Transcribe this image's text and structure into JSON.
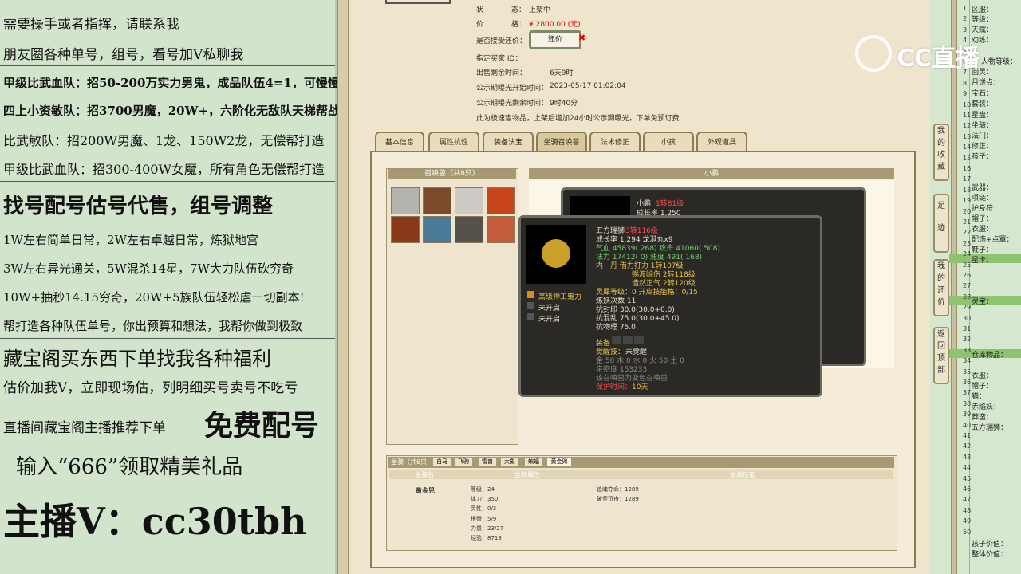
{
  "left_panel": {
    "lines": [
      "需要操手或者指挥，请联系我",
      "朋友圈各种单号，组号，看号加V私聊我",
      "甲级比武血队：招50-200万实力男鬼，成品队伍4=1，可慢慢投资",
      "四上小资敏队：招3700男魔，20W+，六阶化无敌队天梯帮战水陆4等1",
      "比武敏队：招200W男魔、1龙、150W2龙，无偿帮打造",
      "甲级比武血队：招300-400W女魔，所有角色无偿帮打造",
      "找号配号估号代售，组号调整",
      "1W左右简单日常，2W左右卓越日常，炼狱地宫",
      "3W左右异光通关，5W混杀14星，7W大力队伍砍穷奇",
      "10W+抽秒14.15穷奇，20W+5族队伍轻松虐一切副本!",
      "帮打造各种队伍单号，你出预算和想法，我帮你做到极致",
      "藏宝阁买东西下单找我各种福利",
      "估价加我V，立即现场估，列明细买号卖号不吃亏",
      "直播间藏宝阁主播推荐下单",
      "免费配号",
      "输入“666”领取精美礼品",
      "主播V：cc30tbh"
    ]
  },
  "listing": {
    "status_label": "状",
    "status_label2": "态：",
    "status_value": "上架中",
    "price_label": "价",
    "price_label2": "格：",
    "price_value": "¥ 2800.00 (元)",
    "bargain_label": "是否接受还价：",
    "bargain_button": "还价",
    "buyer_id_label": "指定买家 ID：",
    "remaining_label": "出售剩余时间：",
    "remaining_value": "6天9时",
    "public_start_label": "公示期曝光开始时间：",
    "public_start_value": "2023-05-17 01:02:04",
    "public_remaining_label": "公示期曝光剩余时间：",
    "public_remaining_value": "9时40分",
    "notice": "此为极速售物品，上架后增加24小时公示期曝光，下单免预订费"
  },
  "tabs": [
    "基本信息",
    "属性抗性",
    "装备法宝",
    "坐骑召唤兽",
    "法术修正",
    "小孩",
    "外观道具"
  ],
  "summon_panel": {
    "title": "召唤兽（共8只）",
    "child_title": "小鹏"
  },
  "tooltip_back": {
    "name": "小鹏",
    "level": "1转81级",
    "growth": "成长率 1.250"
  },
  "tooltip": {
    "name": "五方瑞狮",
    "level": "3转116级",
    "growth": "成长率 1.294 龙涎丸x9",
    "hp": "气血 45839( 268) 攻击 41060( 508)",
    "mp": "法力 17412( 0) 速度 491( 168)",
    "dan1": "内　丹 借力打力 1转107级",
    "dan2": "赐渡除伤 2转118级",
    "dan3": "造然正气 2转120级",
    "spirit": "灵犀等级：0 开启技能格：0/15",
    "refine": "炼妖次数 11",
    "resist1": "抗封印 30.0(30.0+0.0)",
    "resist2": "抗混乱 75.0(30.0+45.0)",
    "resist3": "抗物理 75.0",
    "equip_label": "装备",
    "awaken": "觉醒技：",
    "awaken_value": "未觉醒",
    "elements": "金 50 木 0 水 0 火 50 土 0",
    "affection": "亲密度 153233",
    "summon_note": "该召唤兽为变色召唤兽",
    "protect": "保护时间：",
    "protect_value": "10天",
    "skills": [
      "高级神工鬼力",
      "未开启",
      "未开启"
    ]
  },
  "mount_panel": {
    "tabs": [
      "坐骑（共6只",
      "白马",
      "飞驹",
      "雷兽",
      "大象",
      "蝙蝠",
      "黄金兕"
    ],
    "header_name": "坐骑名",
    "header_attr": "坐骑属性",
    "header_skill": "坐骑技能",
    "name": "黄金兕",
    "attrs": [
      "等级：24",
      "体力：350",
      "灵性：0/3",
      "根骨：5/9",
      "力量：23/27",
      "经验：8713"
    ],
    "skills": [
      "追魂夺命：1289",
      "破釜沉舟：1289"
    ]
  },
  "watermark": "CC直播",
  "side_buttons": [
    "我的收藏",
    "足迹",
    "我的还价",
    "返回顶部"
  ],
  "right_list": [
    "区服：",
    "等级：",
    "天赋：",
    "劝练：",
    "人物等级：",
    "回灵：",
    "月饼点：",
    "宝石：",
    "套装：",
    "星盘：",
    "坐骑：",
    "法门：",
    "修正：",
    "孩子：",
    "武器：",
    "项链：",
    "护身符：",
    "帽子：",
    "衣服：",
    "配饰+点罩：",
    "鞋子：",
    "星卡：",
    "灵宝：",
    "仓库物品：",
    "衣服：",
    "帽子：",
    "猫：",
    "赤焰妖：",
    "莽蛮：",
    "五方瑞狮：",
    "孩子价值：",
    "整体价值："
  ],
  "right_ticks": [
    "1",
    "2",
    "3",
    "4",
    "5",
    "6",
    "7",
    "8",
    "9",
    "10",
    "11",
    "12",
    "13",
    "14",
    "15",
    "16",
    "17",
    "18",
    "19",
    "20",
    "21",
    "22",
    "23",
    "24",
    "25",
    "26",
    "27",
    "28",
    "29",
    "30",
    "31",
    "32",
    "33",
    "34",
    "35",
    "36",
    "37",
    "38",
    "39",
    "40",
    "41",
    "42",
    "43",
    "44",
    "45",
    "46",
    "47",
    "48",
    "49",
    "50"
  ]
}
